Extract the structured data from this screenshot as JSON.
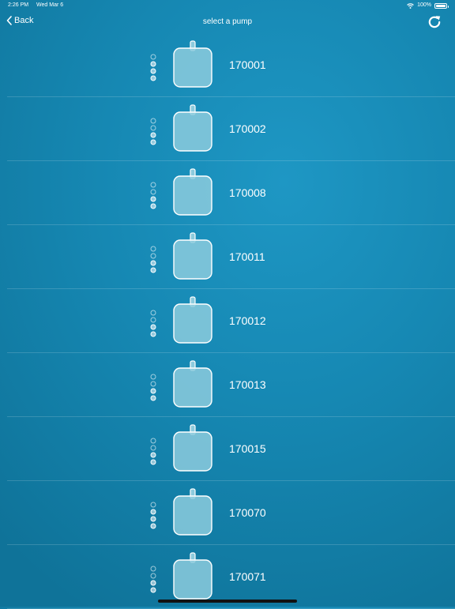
{
  "status_bar": {
    "time": "2:26 PM",
    "date": "Wed Mar 6",
    "battery": "100%"
  },
  "nav": {
    "back_label": "Back",
    "title": "select a pump"
  },
  "pumps": [
    {
      "id": "170001",
      "dots": [
        false,
        true,
        true,
        true
      ]
    },
    {
      "id": "170002",
      "dots": [
        false,
        false,
        true,
        true
      ]
    },
    {
      "id": "170008",
      "dots": [
        false,
        false,
        true,
        true
      ]
    },
    {
      "id": "170011",
      "dots": [
        false,
        false,
        true,
        true
      ]
    },
    {
      "id": "170012",
      "dots": [
        false,
        false,
        true,
        true
      ]
    },
    {
      "id": "170013",
      "dots": [
        false,
        false,
        true,
        true
      ]
    },
    {
      "id": "170015",
      "dots": [
        false,
        false,
        true,
        true
      ]
    },
    {
      "id": "170070",
      "dots": [
        false,
        true,
        true,
        true
      ]
    },
    {
      "id": "170071",
      "dots": [
        false,
        false,
        true,
        true
      ]
    }
  ],
  "colors": {
    "background": "#1688b3",
    "pump_fill": "#8ccbdd"
  }
}
